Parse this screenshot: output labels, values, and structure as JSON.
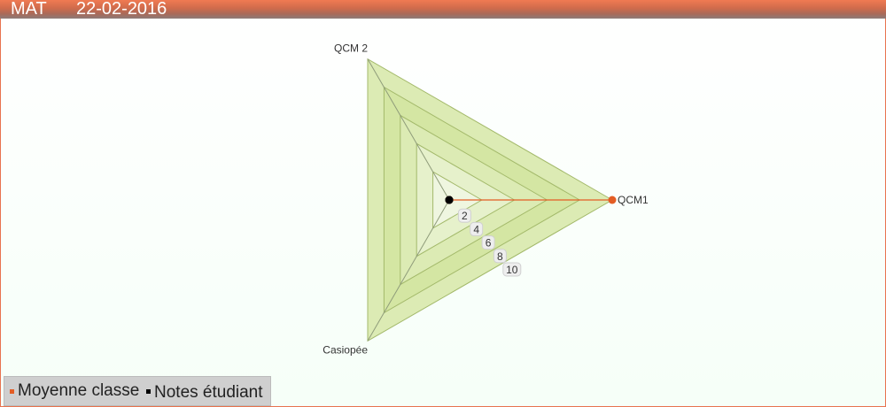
{
  "header": {
    "subject": "MAT",
    "date": "22-02-2016"
  },
  "colors": {
    "moyenne": "#e35d24",
    "notes": "#000000",
    "band_fill": "#d4e6a3",
    "band_stroke": "#a3b96a"
  },
  "chart_data": {
    "type": "radar",
    "axes": [
      "QCM1",
      "QCM 2",
      "Casiopée"
    ],
    "scale_ticks": [
      2,
      4,
      6,
      8,
      10
    ],
    "range": [
      0,
      10
    ],
    "series": [
      {
        "name": "Moyenne classe",
        "values": [
          10,
          0,
          0
        ],
        "color": "#e35d24"
      },
      {
        "name": "Notes étudiant",
        "values": [
          0,
          0,
          0
        ],
        "color": "#000000"
      }
    ]
  },
  "legend": {
    "moyenne_label": "Moyenne classe",
    "notes_label": "Notes étudiant"
  }
}
